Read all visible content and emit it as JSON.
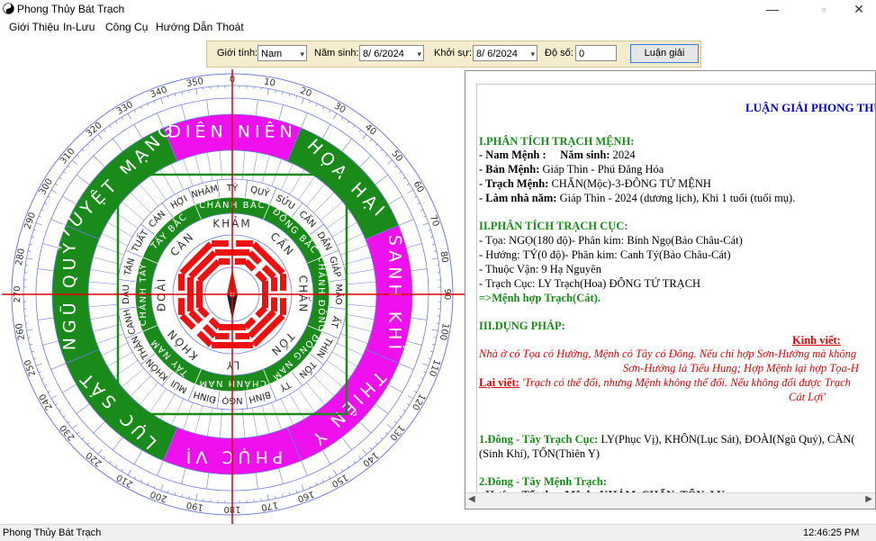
{
  "window": {
    "title": "Phong Thủy Bát Trạch",
    "controls": {
      "minimize": "—",
      "maximize": "▫",
      "close": "✕"
    }
  },
  "menu": [
    "Giới Thiệu",
    "In-Lưu",
    "Công Cụ",
    "Hướng Dẫn",
    "Thoát"
  ],
  "form": {
    "gender_label": "Giới tính:",
    "gender_value": "Nam",
    "birth_label": "Năm sinh:",
    "birth_value": "8/ 6/2024",
    "start_label": "Khởi sự:",
    "start_value": "8/ 6/2024",
    "degree_label": "Độ số:",
    "degree_value": "0",
    "submit_label": "Luận giải"
  },
  "compass": {
    "degree_labels": [
      "0",
      "10",
      "20",
      "30",
      "40",
      "50",
      "60",
      "70",
      "80",
      "90",
      "100",
      "110",
      "120",
      "130",
      "140",
      "150",
      "160",
      "170",
      "180",
      "190",
      "200",
      "210",
      "220",
      "230",
      "240",
      "250",
      "260",
      "270",
      "280",
      "290",
      "300",
      "310",
      "320",
      "330",
      "340",
      "350"
    ],
    "stars_ring": [
      {
        "label": "DIÊN NIÊN",
        "color": "#ee11ee"
      },
      {
        "label": "HỌA HẠI",
        "color": "#1a8a1a"
      },
      {
        "label": "SANH KHÍ",
        "color": "#ee11ee"
      },
      {
        "label": "THIÊN Y",
        "color": "#ee11ee"
      },
      {
        "label": "PHỤC VỊ",
        "color": "#ee11ee"
      },
      {
        "label": "LỤC SÁT",
        "color": "#1a8a1a"
      },
      {
        "label": "NGŨ QUỶ",
        "color": "#1a8a1a"
      },
      {
        "label": "TUYỆT MẠNG",
        "color": "#1a8a1a"
      }
    ],
    "mountains": [
      "TÝ",
      "QUÝ",
      "SỬU",
      "CẤN",
      "DẦN",
      "GIÁP",
      "MÃO",
      "ẤT",
      "THÌN",
      "TỐN",
      "TỴ",
      "BÍNH",
      "NGỌ",
      "ĐINH",
      "MÙI",
      "KHÔN",
      "THÂN",
      "CANH",
      "DẬU",
      "TÂN",
      "TUẤT",
      "CÀN",
      "HỢI",
      "NHÂM"
    ],
    "directions": [
      "CHÁNH BẮC",
      "ĐÔNG BẮC",
      "CHÁNH ĐÔNG",
      "ĐÔNG NAM",
      "CHÁNH NAM",
      "TÂY NAM",
      "CHÁNH TÂY",
      "TÂY BẮC"
    ],
    "trigrams": [
      "KHẢM",
      "CẤN",
      "CHẤN",
      "TỐN",
      "LY",
      "KHÔN",
      "ĐOÀI",
      "CÀN"
    ]
  },
  "report": {
    "title": "LUẬN GIẢI PHONG THỦY",
    "s1_heading": "I.PHÂN TÍCH TRẠCH MỆNH:",
    "s1_l1_key": "- Nam Mệnh :",
    "s1_l1_mid": "Năm sinh:",
    "s1_l1_val": "2024",
    "s1_l2_key": "- Bản Mệnh:",
    "s1_l2_val": "Giáp Thìn - Phú Đăng Hỏa",
    "s1_l3_key": "- Trạch Mệnh:",
    "s1_l3_val": "CHẤN(Mộc)-3-ĐÔNG TỨ MỆNH",
    "s1_l4_key": "- Làm nhà năm:",
    "s1_l4_val": "Giáp Thìn - 2024 (dương lịch), Khi 1 tuổi (tuổi mụ).",
    "s2_heading": "II.PHÂN TÍCH TRẠCH CỤC:",
    "s2_l1": "- Tọa: NGỌ(180 độ)- Phân kim: Bính Ngọ(Bảo Châu-Cát)",
    "s2_l2": "- Hướng: TÝ(0 độ)- Phân kim: Canh Tý(Bảo Châu-Cát)",
    "s2_l3": "- Thuộc Vận: 9 Hạ Nguyên",
    "s2_l4": "- Trạch Cục: LY Trạch(Hoa) ĐÔNG TỨ TRẠCH",
    "s2_result": "=>Mệnh hợp Trạch(Cát).",
    "s3_heading": "III.DỤNG PHÁP:",
    "kinh_viet": "Kinh viết:",
    "quote1_a": "Nhà ở có Tọa có Hướng, Mệnh có Tây có Đông. Nếu chỉ hợp Sơn-Hướng mà không",
    "quote1_b": "Sơn-Hướng là Tiểu Hung; Hợp Mệnh lại hợp Tọa-H",
    "lai_viet": "Lại viết:",
    "quote2_a": "'Trạch có thể đổi, nhưng Mệnh không thể đổi. Nếu không đổi được Trạch",
    "quote2_b": "Cát Lợi'",
    "p1_heading": "1.Đông - Tây Trạch Cục:",
    "p1_text_a": "LY(Phục Vị), KHÔN(Lục Sát), ĐOÀI(Ngũ Quỷ), CÀN(",
    "p1_text_b": "(Sinh Khí), TỐN(Thiên Y)",
    "p2_heading": "2.Đông - Tây Mệnh Trạch:",
    "p2_cut": "- Hướng Tốt theo Mệnh: KHẢM, CHẤN, TỐN, LY"
  },
  "status": {
    "left": "Phong Thủy Bát Trạch",
    "time": "12:46:25 PM"
  }
}
